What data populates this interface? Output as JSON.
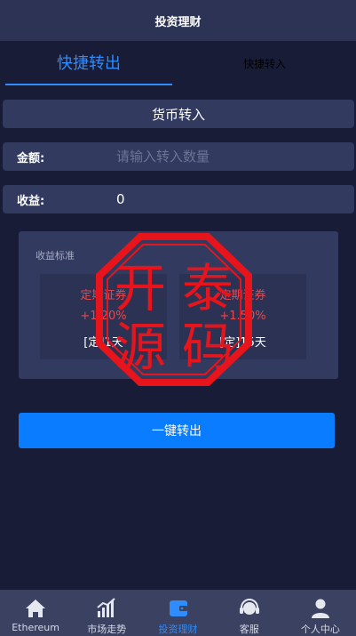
{
  "header": {
    "title": "投资理财"
  },
  "tabs": [
    {
      "label": "快捷转出",
      "active": true
    },
    {
      "label": "快捷转入",
      "active": false
    }
  ],
  "section": {
    "title": "货币转入"
  },
  "form": {
    "amount_label": "金额:",
    "amount_placeholder": "请输入转入数量",
    "amount_value": "",
    "income_label": "收益:",
    "income_value": "0"
  },
  "standard": {
    "title": "收益标准",
    "products": [
      {
        "name": "定期证券",
        "rate": "+1.20%",
        "term": "[定]1天"
      },
      {
        "name": "定期证券",
        "rate": "+1.50%",
        "term": "[定]15天"
      }
    ]
  },
  "stamp": {
    "text": [
      "开",
      "泰",
      "源",
      "码"
    ],
    "color": "#e8141c"
  },
  "action": {
    "label": "一键转出"
  },
  "nav": {
    "items": [
      {
        "label": "Ethereum",
        "icon": "home-icon",
        "active": false
      },
      {
        "label": "市场走势",
        "icon": "chart-icon",
        "active": false
      },
      {
        "label": "投资理财",
        "icon": "wallet-icon",
        "active": true
      },
      {
        "label": "客服",
        "icon": "headset-icon",
        "active": false
      },
      {
        "label": "个人中心",
        "icon": "user-icon",
        "active": false
      }
    ]
  },
  "colors": {
    "background": "#181c36",
    "panel": "#323a5f",
    "accent": "#2e8cff",
    "button": "#0a7cff",
    "rate_red": "#e8484e"
  }
}
